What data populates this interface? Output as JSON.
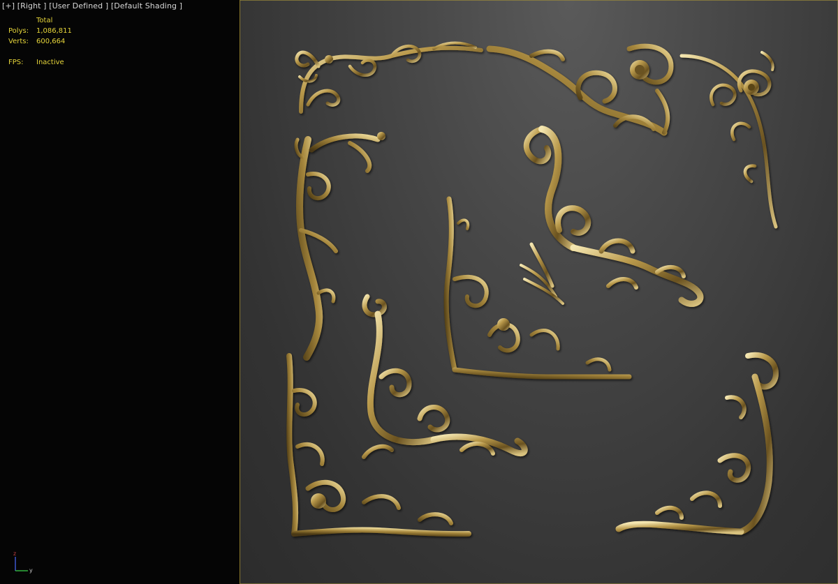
{
  "viewport": {
    "label_parts": [
      "[+]",
      "[Right ]",
      "[User Defined ]",
      "[Default Shading ]"
    ]
  },
  "stats": {
    "header": "Total",
    "polys_label": "Polys:",
    "polys_value": "1,086,811",
    "verts_label": "Verts:",
    "verts_value": "600,664",
    "fps_label": "FPS:",
    "fps_value": "Inactive"
  },
  "axis": {
    "z": "z",
    "y": "y"
  },
  "colors": {
    "gold_light": "#f2e2a6",
    "gold_mid": "#a88a3e",
    "gold_dark": "#3a2c10",
    "stats_text": "#e6d53a",
    "panel_border": "#9b8a3a"
  },
  "ornaments": [
    "ornament-top-left-corner",
    "ornament-top-center-corner",
    "ornament-top-right-corner",
    "ornament-left-vertical-scroll",
    "ornament-center-large-acanthus",
    "ornament-center-small-corner",
    "ornament-center-scroll-corner",
    "ornament-bottom-left-corner",
    "ornament-bottom-right-corner"
  ]
}
